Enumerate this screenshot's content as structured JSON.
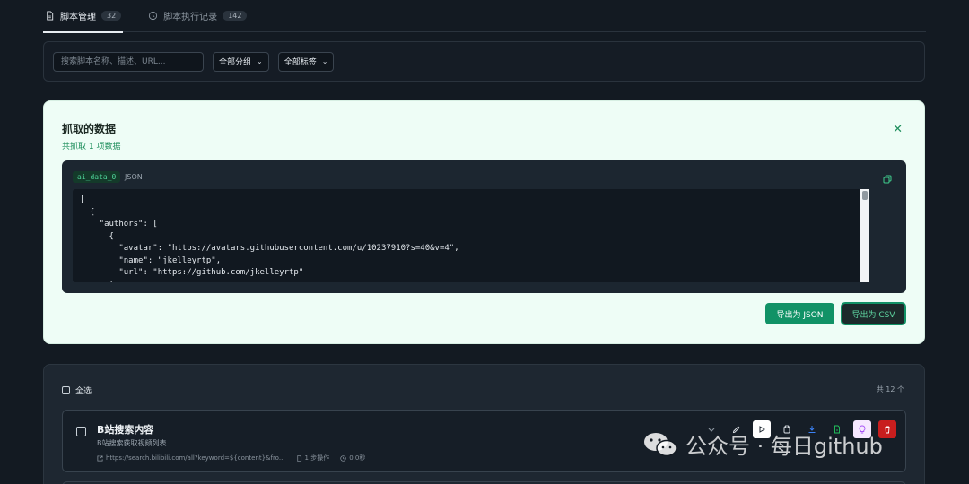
{
  "tabs": [
    {
      "label": "脚本管理",
      "count": "32",
      "active": true
    },
    {
      "label": "脚本执行记录",
      "count": "142",
      "active": false
    }
  ],
  "filters": {
    "search_placeholder": "搜索脚本名称、描述、URL...",
    "group_select": "全部分组",
    "tag_select": "全部标签"
  },
  "data_panel": {
    "title": "抓取的数据",
    "subtitle": "共抓取 1 项数据",
    "code_tag": "ai_data_0",
    "code_format": "JSON",
    "code_content": "[\n  {\n    \"authors\": [\n      {\n        \"avatar\": \"https://avatars.githubusercontent.com/u/10237910?s=40&v=4\",\n        \"name\": \"jkelleyrtp\",\n        \"url\": \"https://github.com/jkelleyrtp\"\n      },",
    "export_json_label": "导出为 JSON",
    "export_csv_label": "导出为 CSV"
  },
  "list": {
    "select_all_label": "全选",
    "total_label": "共 12 个",
    "scripts": [
      {
        "title": "B站搜索内容",
        "description": "B站搜索获取视频列表",
        "url": "https://search.bilibili.com/all?keyword=${content}&fro...",
        "steps": "1 步操作",
        "duration": "0.0秒"
      }
    ]
  },
  "watermark": {
    "text": "公众号 · 每日github"
  },
  "colors": {
    "accent_green": "#119266",
    "delete_red": "#c81e1e",
    "panel_bg": "#eefdf6"
  }
}
